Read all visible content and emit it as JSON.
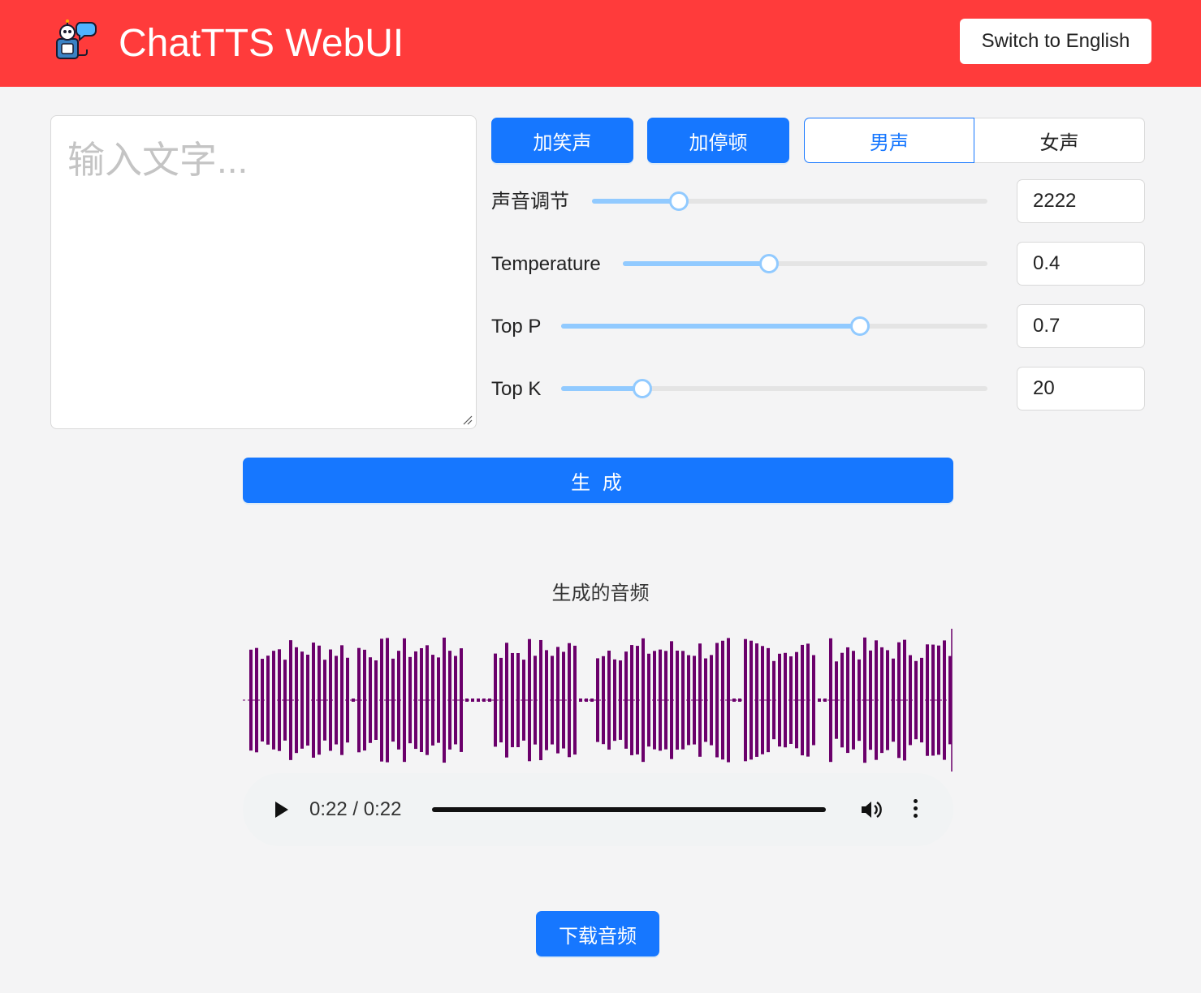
{
  "header": {
    "logo_icon": "robot-speech-icon",
    "title": "ChatTTS WebUI",
    "lang_button": "Switch to English",
    "bg_color": "#ff3b3b"
  },
  "input": {
    "placeholder": "输入文字...",
    "value": ""
  },
  "controls": {
    "laugh_button": "加笑声",
    "pause_button": "加停顿",
    "voice_options": [
      "男声",
      "女声"
    ],
    "voice_selected": "男声"
  },
  "sliders": [
    {
      "label": "声音调节",
      "value": "2222",
      "fill_fraction": 0.22
    },
    {
      "label": "Temperature",
      "value": "0.4",
      "fill_fraction": 0.4
    },
    {
      "label": "Top P",
      "value": "0.7",
      "fill_fraction": 0.7
    },
    {
      "label": "Top K",
      "value": "20",
      "fill_fraction": 0.19
    }
  ],
  "generate_button": "生 成",
  "audio": {
    "title": "生成的音频",
    "time": "0:22 / 0:22",
    "progress_fraction": 1.0,
    "wave_color": "#6b006b",
    "play_icon": "play-icon",
    "volume_icon": "volume-icon",
    "more_icon": "more-vertical-icon"
  },
  "download_button": "下载音频",
  "colors": {
    "primary": "#1677ff",
    "slider": "#91caff"
  }
}
